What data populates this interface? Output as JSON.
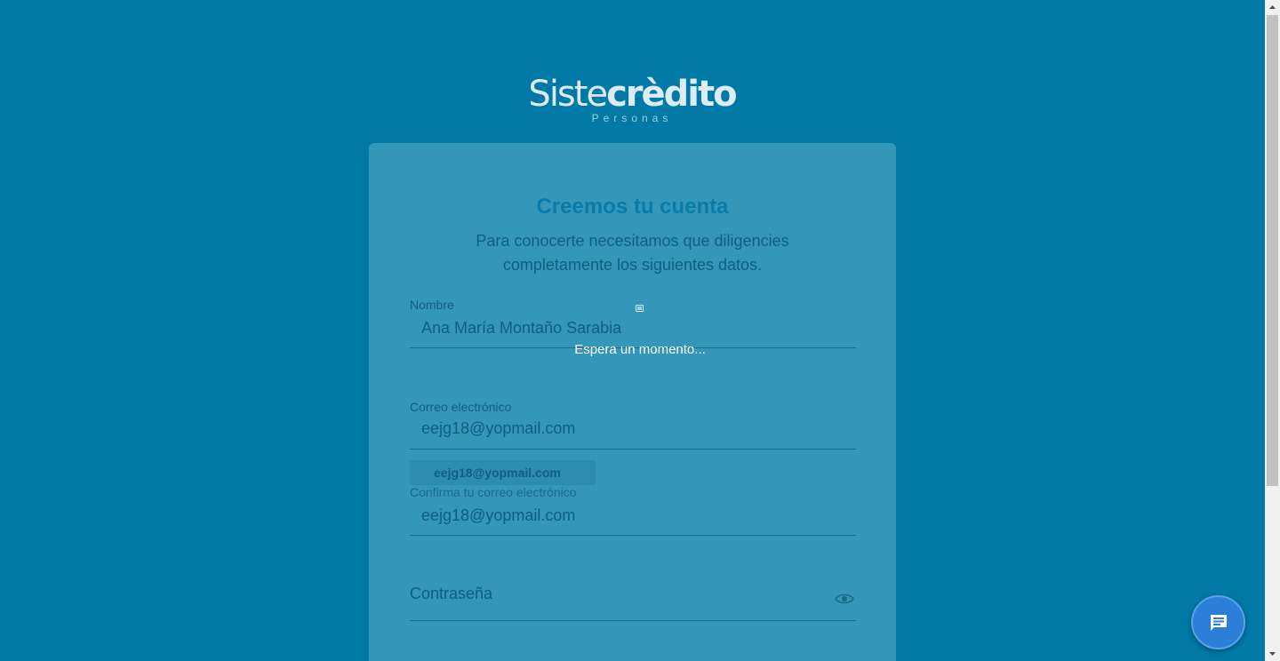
{
  "logo": {
    "word_light": "Siste",
    "word_bold": "crèdito",
    "sub": "Personas"
  },
  "form": {
    "title": "Creemos tu cuenta",
    "subtitle": "Para conocerte necesitamos que diligencies completamente los siguientes datos.",
    "name": {
      "label": "Nombre",
      "value": "Ana María Montaño Sarabia"
    },
    "email": {
      "label": "Correo electrónico",
      "value": "eejg18@yopmail.com"
    },
    "autocomplete_suggestion": "eejg18@yopmail.com",
    "confirm_email": {
      "label": "Confirma tu correo electrónico",
      "value": "eejg18@yopmail.com"
    },
    "password": {
      "placeholder": "Contraseña",
      "toggle_icon": "eye-icon"
    }
  },
  "loading": {
    "text": "Espera un momento..."
  },
  "chat": {
    "icon": "chat-bubble-icon"
  },
  "colors": {
    "background": "#0079a7",
    "card": "#3496b9",
    "title": "#0a7ba8",
    "chat": "#2b7fd8"
  }
}
